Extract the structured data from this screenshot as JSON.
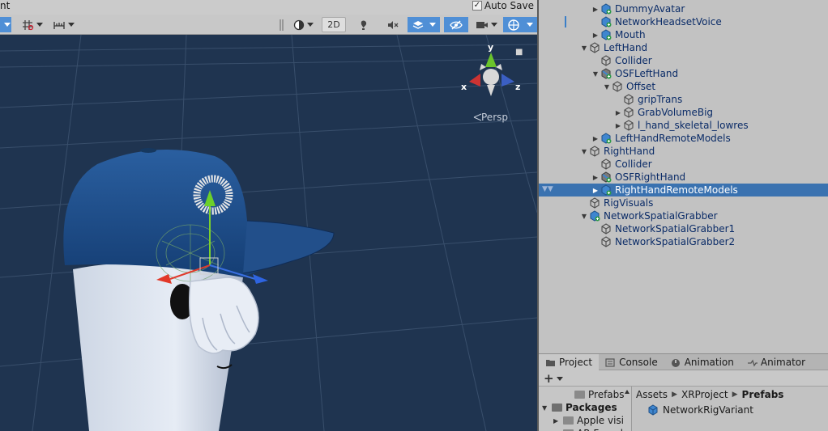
{
  "scene": {
    "title": "nt",
    "auto_save_label": "Auto Save",
    "auto_save_checked": "✓",
    "toolbar": {
      "mode_2d": "2D"
    },
    "persp_label": "Persp",
    "axis_labels": {
      "x": "x",
      "y": "y",
      "z": "z"
    }
  },
  "hierarchy": {
    "items": [
      {
        "label": "DummyAvatar",
        "depth": 3,
        "arrow": "collapsed",
        "icon": "prefab-network-icon",
        "style": "blue"
      },
      {
        "label": "NetworkHeadsetVoice",
        "depth": 3,
        "arrow": "none",
        "icon": "prefab-network-icon",
        "style": "blue"
      },
      {
        "label": "Mouth",
        "depth": 3,
        "arrow": "collapsed",
        "icon": "prefab-network-icon",
        "style": "blue"
      },
      {
        "label": "LeftHand",
        "depth": 2,
        "arrow": "expanded",
        "icon": "gameobject-icon",
        "style": "blue"
      },
      {
        "label": "Collider",
        "depth": 3,
        "arrow": "none",
        "icon": "gameobject-icon",
        "style": "blue"
      },
      {
        "label": "OSFLeftHand",
        "depth": 3,
        "arrow": "expanded",
        "icon": "prefab-variant-icon",
        "style": "blue"
      },
      {
        "label": "Offset",
        "depth": 4,
        "arrow": "expanded",
        "icon": "gameobject-icon",
        "style": "blue"
      },
      {
        "label": "gripTrans",
        "depth": 5,
        "arrow": "none",
        "icon": "gameobject-icon",
        "style": "blue"
      },
      {
        "label": "GrabVolumeBig",
        "depth": 5,
        "arrow": "collapsed",
        "icon": "gameobject-icon",
        "style": "blue"
      },
      {
        "label": "l_hand_skeletal_lowres",
        "depth": 5,
        "arrow": "collapsed",
        "icon": "gameobject-icon",
        "style": "blue"
      },
      {
        "label": "LeftHandRemoteModels",
        "depth": 3,
        "arrow": "collapsed",
        "icon": "prefab-network-icon",
        "style": "blue"
      },
      {
        "label": "RightHand",
        "depth": 2,
        "arrow": "expanded",
        "icon": "gameobject-icon",
        "style": "blue"
      },
      {
        "label": "Collider",
        "depth": 3,
        "arrow": "none",
        "icon": "gameobject-icon",
        "style": "blue"
      },
      {
        "label": "OSFRightHand",
        "depth": 3,
        "arrow": "collapsed",
        "icon": "prefab-variant-icon",
        "style": "blue"
      },
      {
        "label": "RightHandRemoteModels",
        "depth": 3,
        "arrow": "collapsed",
        "icon": "prefab-network-icon",
        "style": "selected"
      },
      {
        "label": "RigVisuals",
        "depth": 2,
        "arrow": "none",
        "icon": "gameobject-icon",
        "style": "blue"
      },
      {
        "label": "NetworkSpatialGrabber",
        "depth": 2,
        "arrow": "expanded",
        "icon": "prefab-network-icon",
        "style": "blue"
      },
      {
        "label": "NetworkSpatialGrabber1",
        "depth": 3,
        "arrow": "none",
        "icon": "gameobject-icon",
        "style": "blue"
      },
      {
        "label": "NetworkSpatialGrabber2",
        "depth": 3,
        "arrow": "none",
        "icon": "gameobject-icon",
        "style": "blue"
      }
    ]
  },
  "project_panel": {
    "tabs": [
      {
        "label": "Project",
        "icon": "folder-icon",
        "active": true
      },
      {
        "label": "Console",
        "icon": "console-icon",
        "active": false
      },
      {
        "label": "Animation",
        "icon": "animation-icon",
        "active": false
      },
      {
        "label": "Animator",
        "icon": "animator-icon",
        "active": false
      }
    ],
    "add_button": "+",
    "folders": [
      {
        "label": "Prefabs",
        "depth": 2,
        "arrow": "none",
        "open": false
      },
      {
        "label": "Packages",
        "depth": 0,
        "arrow": "expanded",
        "open": true,
        "bold": true
      },
      {
        "label": "Apple visi",
        "depth": 1,
        "arrow": "collapsed",
        "open": false
      },
      {
        "label": "AR Found",
        "depth": 1,
        "arrow": "collapsed",
        "open": false
      }
    ],
    "breadcrumb": [
      "Assets",
      "XRProject",
      "Prefabs"
    ],
    "assets": [
      {
        "label": "NetworkRigVariant",
        "icon": "prefab-icon"
      }
    ]
  },
  "colors": {
    "scene_bg": "#1f3450",
    "selection": "#3a72b0",
    "hierarchy_text": "#0a2b67",
    "toolbar_active": "#4f8fd6"
  }
}
